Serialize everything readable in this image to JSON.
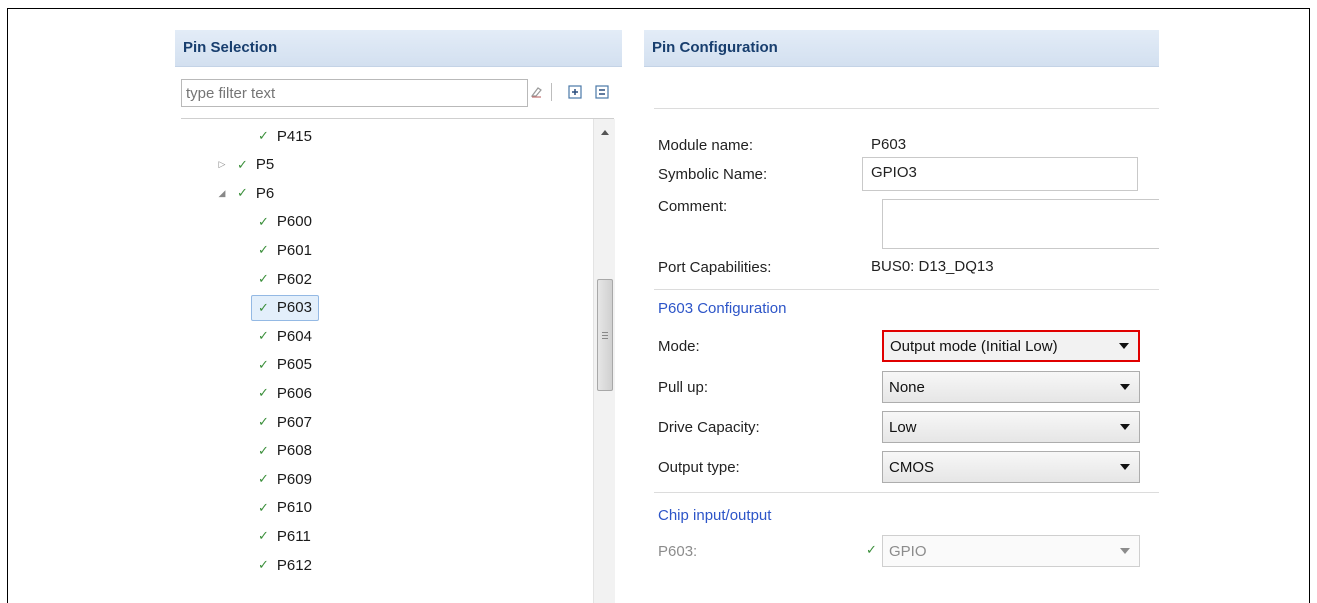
{
  "pin_selection": {
    "title": "Pin Selection",
    "filter_placeholder": "type filter text",
    "tree": [
      {
        "label": "P415",
        "level": 2
      },
      {
        "label": "P5",
        "level": 1,
        "expander": "collapsed"
      },
      {
        "label": "P6",
        "level": 1,
        "expander": "expanded"
      },
      {
        "label": "P600",
        "level": 2
      },
      {
        "label": "P601",
        "level": 2
      },
      {
        "label": "P602",
        "level": 2
      },
      {
        "label": "P603",
        "level": 2,
        "selected": true
      },
      {
        "label": "P604",
        "level": 2
      },
      {
        "label": "P605",
        "level": 2
      },
      {
        "label": "P606",
        "level": 2
      },
      {
        "label": "P607",
        "level": 2
      },
      {
        "label": "P608",
        "level": 2
      },
      {
        "label": "P609",
        "level": 2
      },
      {
        "label": "P610",
        "level": 2
      },
      {
        "label": "P611",
        "level": 2
      },
      {
        "label": "P612",
        "level": 2
      }
    ]
  },
  "pin_configuration": {
    "title": "Pin Configuration",
    "module_name_label": "Module name:",
    "module_name_value": "P603",
    "symbolic_name_label": "Symbolic Name:",
    "symbolic_name_value": "GPIO3",
    "comment_label": "Comment:",
    "comment_value": "",
    "port_capabilities_label": "Port Capabilities:",
    "port_capabilities_value": "BUS0: D13_DQ13",
    "config_section_title": "P603 Configuration",
    "mode_label": "Mode:",
    "mode_value": "Output mode (Initial Low)",
    "pull_up_label": "Pull up:",
    "pull_up_value": "None",
    "drive_capacity_label": "Drive Capacity:",
    "drive_capacity_value": "Low",
    "output_type_label": "Output type:",
    "output_type_value": "CMOS",
    "chip_io_section_title": "Chip input/output",
    "chip_io_pin_label": "P603:",
    "chip_io_pin_value": "GPIO"
  },
  "colors": {
    "header_title": "#183e6e",
    "section_title": "#2d55c8",
    "check_green": "#3b8f3b",
    "highlight_red": "#e00000"
  }
}
